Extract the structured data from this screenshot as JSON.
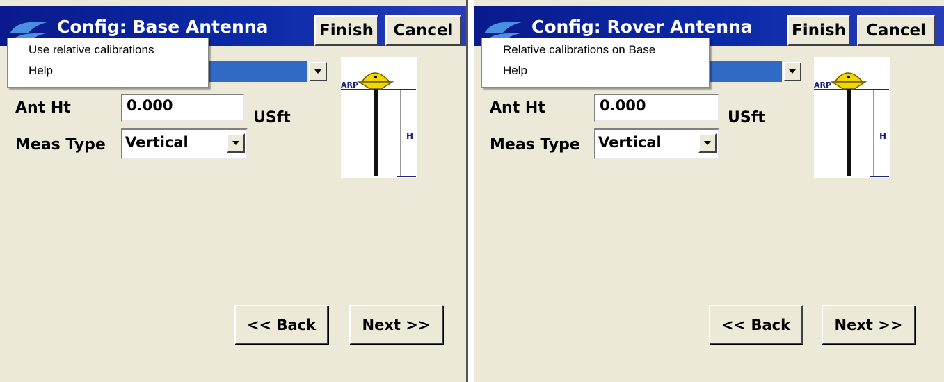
{
  "panels": [
    {
      "title": "Config: Base Antenna",
      "finish_label": "Finish",
      "cancel_label": "Cancel",
      "menu_items": [
        "Use relative calibrations",
        "Help"
      ],
      "ant_ht_label": "Ant Ht",
      "ant_ht_value": "0.000",
      "units": "USft",
      "meas_type_label": "Meas Type",
      "meas_type_value": "Vertical",
      "diagram_arp": "ARP",
      "diagram_h": "H",
      "back_label": "<< Back",
      "next_label": "Next >>"
    },
    {
      "title": "Config: Rover Antenna",
      "finish_label": "Finish",
      "cancel_label": "Cancel",
      "menu_items": [
        "Relative calibrations on Base",
        "Help"
      ],
      "ant_ht_label": "Ant Ht",
      "ant_ht_value": "0.000",
      "units": "USft",
      "meas_type_label": "Meas Type",
      "meas_type_value": "Vertical",
      "diagram_arp": "ARP",
      "diagram_h": "H",
      "back_label": "<< Back",
      "next_label": "Next >>"
    }
  ],
  "icons": {
    "logo": "app-logo-icon",
    "dropdown": "chevron-down-icon",
    "antenna": "antenna-diagram"
  },
  "colors": {
    "titlebar": "#0b2aa8",
    "selection": "#316AC5",
    "window_bg": "#ECE9D8",
    "logo": "#3b7dd8"
  }
}
